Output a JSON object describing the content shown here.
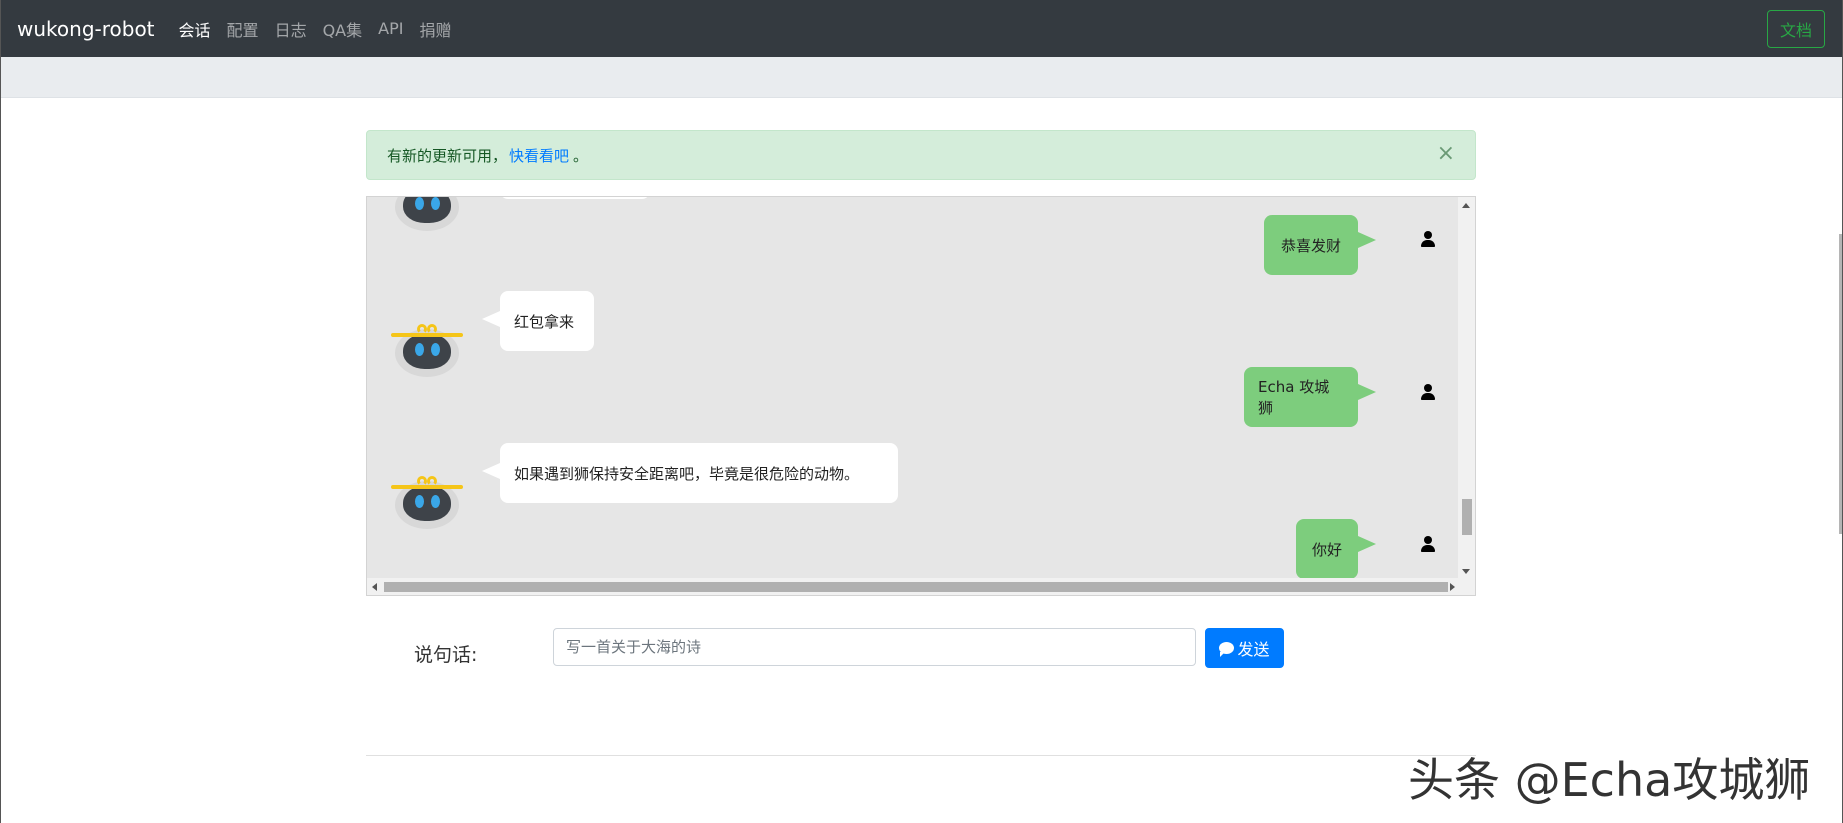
{
  "navbar": {
    "brand": "wukong-robot",
    "links": [
      {
        "label": "会话",
        "active": true
      },
      {
        "label": "配置",
        "active": false
      },
      {
        "label": "日志",
        "active": false
      },
      {
        "label": "QA集",
        "active": false
      },
      {
        "label": "API",
        "active": false
      },
      {
        "label": "捐赠",
        "active": false
      }
    ],
    "doc_button": "文档"
  },
  "alert": {
    "text": "有新的更新可用，",
    "link": "快看看吧",
    "suffix": "。",
    "close": "×"
  },
  "chat": {
    "messages": [
      {
        "from": "user",
        "text": "恭喜发财"
      },
      {
        "from": "robot",
        "text": "红包拿来"
      },
      {
        "from": "user",
        "text": "Echa 攻城狮"
      },
      {
        "from": "robot",
        "text": "如果遇到狮保持安全距离吧，毕竟是很危险的动物。"
      },
      {
        "from": "user",
        "text": "你好"
      }
    ]
  },
  "input": {
    "label": "说句话:",
    "placeholder": "写一首关于大海的诗",
    "send_label": "发送"
  },
  "watermark": "头条 @Echa攻城狮",
  "colors": {
    "navbar_bg": "#343a40",
    "alert_bg": "#d4edda",
    "user_bubble": "#7dcd7d",
    "send_button": "#007bff",
    "doc_button": "#28a745"
  }
}
